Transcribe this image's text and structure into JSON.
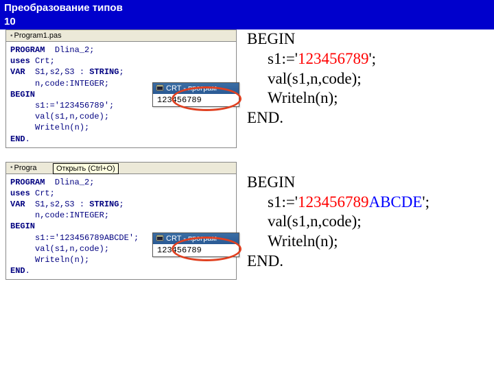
{
  "header": {
    "title": "Преобразование типов",
    "page": "10"
  },
  "left": {
    "tab1": "Program1.pas",
    "tab2": "Progra",
    "tooltip": "Открыть (Ctrl+O)",
    "code1": {
      "l1a": "PROGRAM",
      "l1b": "  Dlina_2;",
      "l2a": "uses",
      "l2b": " Crt;",
      "l3a": "VAR",
      "l3b": "  S1,s2,S3 : ",
      "l3c": "STRING",
      "l3d": ";",
      "l4": "     n,code:INTEGER;",
      "l5": "BEGIN",
      "l6": "     s1:='123456789';",
      "l7": "     val(s1,n,code);",
      "l8": "     Writeln(n);",
      "l9": "END",
      "l9b": "."
    },
    "code2": {
      "l1a": "PROGRAM",
      "l1b": "  Dlina_2;",
      "l2a": "uses",
      "l2b": " Crt;",
      "l3a": "VAR",
      "l3b": "  S1,s2,S3 : ",
      "l3c": "STRING",
      "l3d": ";",
      "l4": "     n,code:INTEGER;",
      "l5": "BEGIN",
      "l6": "     s1:='123456789ABCDE';",
      "l7": "     val(s1,n,code);",
      "l8": "     Writeln(n);",
      "l9": "END",
      "l9b": "."
    },
    "crt_title": "CRT - програм",
    "crt_value": "123456789"
  },
  "right": {
    "b1": {
      "begin": "BEGIN",
      "s1_a": "s1:='",
      "s1_num": "123456789",
      "s1_b": "';",
      "val": "val(s1,n,code);",
      "wr": "Writeln(n);",
      "end": "END."
    },
    "b2": {
      "begin": "BEGIN",
      "s1_a": "s1:='",
      "s1_num": "123456789",
      "s1_abc": "ABCDE",
      "s1_b": "';",
      "val": "val(s1,n,code);",
      "wr": "Writeln(n);",
      "end": "END."
    }
  }
}
